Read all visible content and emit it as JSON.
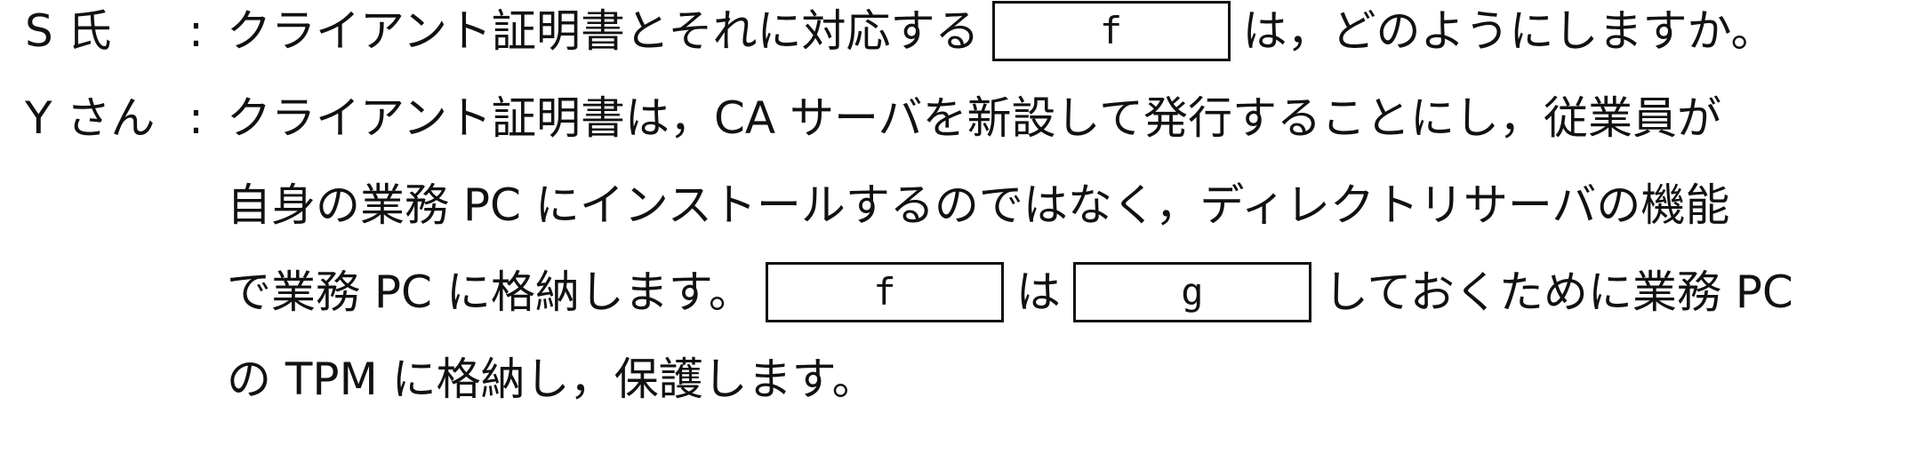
{
  "dialogue": {
    "line1": {
      "speaker": "S 氏",
      "colon": ":",
      "before": "クライアント証明書とそれに対応する",
      "blank": "f",
      "after": "は，どのようにしますか。"
    },
    "line2": {
      "speaker": "Y さん",
      "colon": ":",
      "text": "クライアント証明書は，CA サーバを新設して発行することにし，従業員が"
    },
    "line3": {
      "text": "自身の業務 PC にインストールするのではなく，ディレクトリサーバの機能"
    },
    "line4": {
      "before": "で業務 PC に格納します。",
      "blank1": "f",
      "middle": "は",
      "blank2": "g",
      "after": "しておくために業務 PC"
    },
    "line5": {
      "text": "の TPM に格納し，保護します。"
    }
  }
}
